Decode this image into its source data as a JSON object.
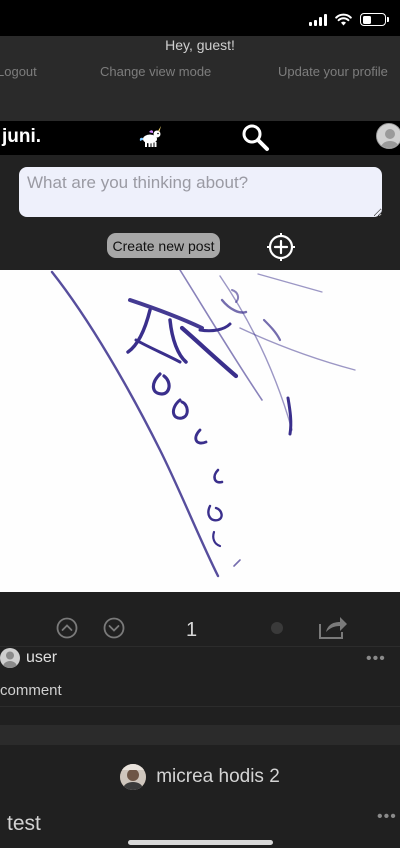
{
  "top_menu": {
    "greeting": "Hey, guest!",
    "logout": "Logout",
    "change_view": "Change view mode",
    "update_profile": "Update your profile"
  },
  "navbar": {
    "brand": "juni.",
    "icons": [
      "unicorn-icon",
      "search-icon",
      "avatar"
    ]
  },
  "compose": {
    "placeholder": "What are you thinking about?",
    "create_label": "Create new post",
    "add_icon": "add-circle-icon"
  },
  "post": {
    "image_content": "handwritten signature (blue ink)",
    "vote_count": "1",
    "comments": [
      {
        "username": "user",
        "text": "comment"
      }
    ]
  },
  "next_post": {
    "author": "micrea hodis 2",
    "text": "test"
  },
  "colors": {
    "background": "#202020",
    "navbar": "#000000",
    "input_bg": "#eef0fb",
    "ink": "#3a2f8c"
  }
}
